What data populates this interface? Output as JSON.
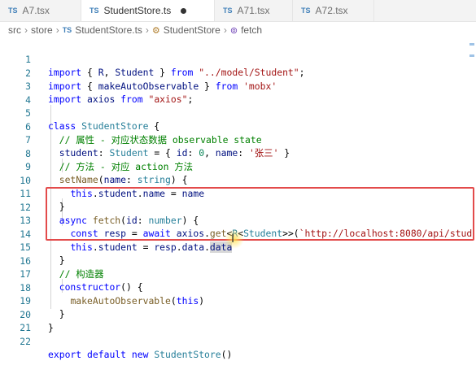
{
  "tabs": [
    {
      "label": "A7.tsx",
      "lang": "TS",
      "active": false
    },
    {
      "label": "StudentStore.ts",
      "lang": "TS",
      "active": true,
      "modified": true
    },
    {
      "label": "A71.tsx",
      "lang": "TS",
      "active": false
    },
    {
      "label": "A72.tsx",
      "lang": "TS",
      "active": false
    }
  ],
  "breadcrumb": {
    "items": [
      "src",
      "store",
      "StudentStore.ts",
      "StudentStore",
      "fetch"
    ],
    "file_lang": "TS"
  },
  "code_lines": [
    {
      "num": "1",
      "code": "import { R, Student } from \"../model/Student\";"
    },
    {
      "num": "2",
      "code": "import { makeAutoObservable } from 'mobx'"
    },
    {
      "num": "3",
      "code": "import axios from \"axios\";"
    },
    {
      "num": "4",
      "code": ""
    },
    {
      "num": "5",
      "code": "class StudentStore {"
    },
    {
      "num": "6",
      "code": "  // 属性 - 对应状态数据 observable state"
    },
    {
      "num": "7",
      "code": "  student: Student = { id: 0, name: '张三' }"
    },
    {
      "num": "8",
      "code": "  // 方法 - 对应 action 方法"
    },
    {
      "num": "9",
      "code": "  setName(name: string) {"
    },
    {
      "num": "10",
      "code": "    this.student.name = name"
    },
    {
      "num": "11",
      "code": "  }"
    },
    {
      "num": "12",
      "code": "  async fetch(id: number) {"
    },
    {
      "num": "13",
      "code": "    const resp = await axios.get<R<Student>>(`http://localhost:8080/api/stud"
    },
    {
      "num": "14",
      "code": "    this.student = resp.data.data"
    },
    {
      "num": "15",
      "code": "  }"
    },
    {
      "num": "16",
      "code": "  // 构造器"
    },
    {
      "num": "17",
      "code": "  constructor() {"
    },
    {
      "num": "18",
      "code": "    makeAutoObservable(this)"
    },
    {
      "num": "19",
      "code": "  }"
    },
    {
      "num": "20",
      "code": "}"
    },
    {
      "num": "21",
      "code": ""
    },
    {
      "num": "22",
      "code": "export default new StudentStore()"
    }
  ],
  "colors": {
    "keyword": "#0000ff",
    "string": "#a31515",
    "comment": "#008000",
    "function": "#795e26",
    "type": "#267f99",
    "variable": "#001080",
    "number": "#098658",
    "highlight_box": "#e34b4b",
    "line_number": "#237893"
  },
  "icons": {
    "ts_badge": "TS",
    "class_icon": "symbol-class-icon",
    "method_icon": "symbol-method-icon",
    "cursor": "text-cursor-icon"
  }
}
